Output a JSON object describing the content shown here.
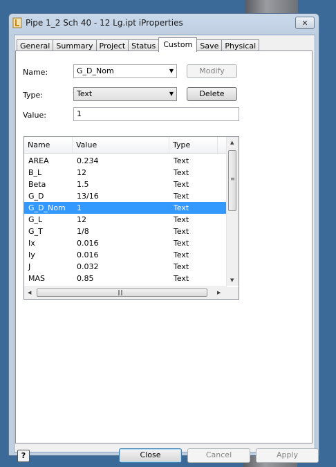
{
  "window": {
    "title": "Pipe 1_2 Sch 40 - 12 Lg.ipt iProperties"
  },
  "tabs": [
    {
      "label": "General"
    },
    {
      "label": "Summary"
    },
    {
      "label": "Project"
    },
    {
      "label": "Status"
    },
    {
      "label": "Custom",
      "active": true
    },
    {
      "label": "Save"
    },
    {
      "label": "Physical"
    }
  ],
  "form": {
    "name_label": "Name:",
    "name_value": "G_D_Nom",
    "type_label": "Type:",
    "type_value": "Text",
    "value_label": "Value:",
    "value_value": "1",
    "modify_label": "Modify",
    "delete_label": "Delete"
  },
  "table": {
    "columns": [
      "Name",
      "Value",
      "Type"
    ],
    "rows": [
      [
        "AREA",
        "0.234",
        "Text"
      ],
      [
        "B_L",
        "12",
        "Text"
      ],
      [
        "Beta",
        "1.5",
        "Text"
      ],
      [
        "G_D",
        "13/16",
        "Text"
      ],
      [
        "G_D_Nom",
        "1",
        "Text"
      ],
      [
        "G_L",
        "12",
        "Text"
      ],
      [
        "G_T",
        "1/8",
        "Text"
      ],
      [
        "Ix",
        "0.016",
        "Text"
      ],
      [
        "Iy",
        "0.016",
        "Text"
      ],
      [
        "J",
        "0.032",
        "Text"
      ],
      [
        "MAS",
        "0.85",
        "Text"
      ]
    ],
    "selected_row": "G_D_Nom"
  },
  "buttons": {
    "help": "?",
    "close": "Close",
    "cancel": "Cancel",
    "apply": "Apply"
  },
  "colors": {
    "selection": "#3399ff",
    "desktop": "#3b6a98"
  }
}
